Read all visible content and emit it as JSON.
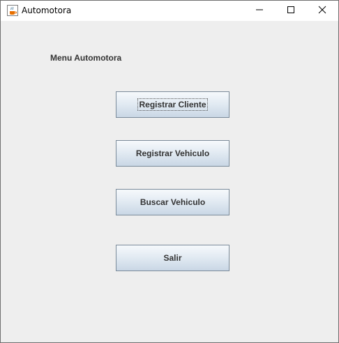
{
  "window": {
    "title": "Automotora",
    "icon": "java-cup-icon",
    "controls": {
      "minimize": "minimize-icon",
      "maximize": "maximize-icon",
      "close": "close-icon"
    }
  },
  "main": {
    "menu_label": "Menu Automotora",
    "buttons": {
      "registrar_cliente": "Registrar Cliente",
      "registrar_vehiculo": "Registrar Vehiculo",
      "buscar_vehiculo": "Buscar Vehiculo",
      "salir": "Salir"
    },
    "focused_button": "Registrar Cliente"
  },
  "colors": {
    "window_background": "#eeeeee",
    "button_border": "#7a8a99",
    "button_gradient_top": "#f6f9fc",
    "button_gradient_bottom": "#c9d7e5",
    "text": "#333333"
  }
}
